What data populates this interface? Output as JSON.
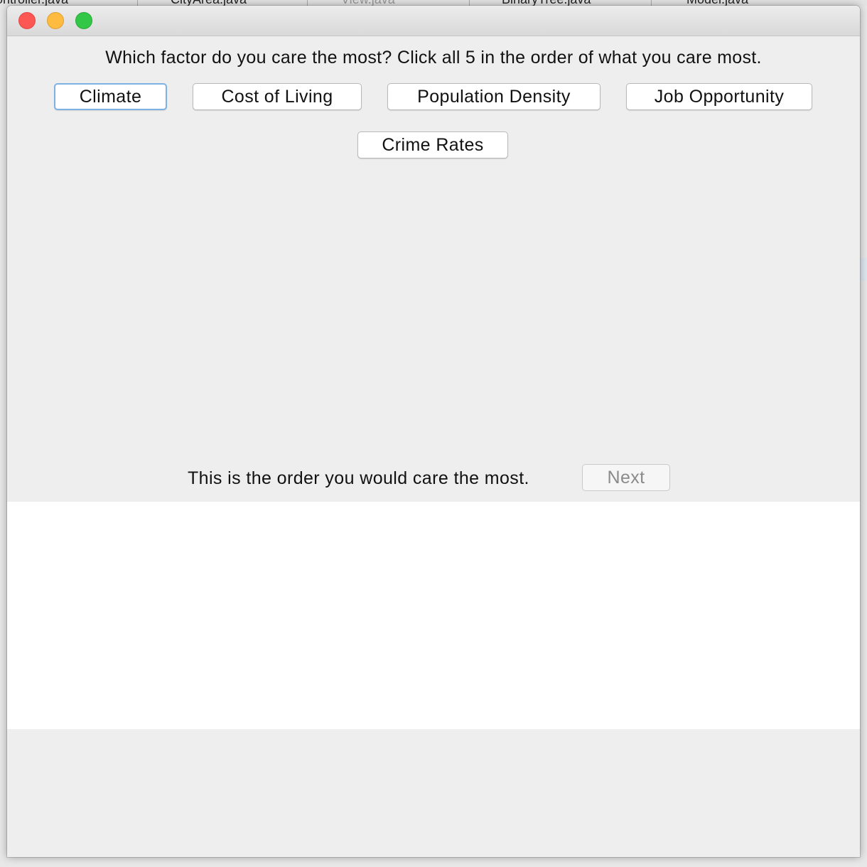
{
  "background": {
    "tabs": [
      {
        "label": "ontroller.java",
        "dim": false
      },
      {
        "label": "CityArea.java",
        "dim": false
      },
      {
        "label": "View.java",
        "dim": true
      },
      {
        "label": "BinaryTree.java",
        "dim": false
      },
      {
        "label": "Model.java",
        "dim": false
      }
    ]
  },
  "window": {
    "controls": {
      "close": "close-icon",
      "minimize": "minimize-icon",
      "maximize": "maximize-icon"
    },
    "question": "Which factor do you care the most? Click all 5 in the order of what you care most.",
    "factors": [
      {
        "label": "Climate"
      },
      {
        "label": "Cost of Living"
      },
      {
        "label": "Population Density"
      },
      {
        "label": "Job Opportunity"
      },
      {
        "label": "Crime Rates"
      }
    ],
    "order_label": "This is the order you would care the most.",
    "next_label": "Next",
    "result_text": ""
  },
  "colors": {
    "close": "#fc5753",
    "minimize": "#fdbc40",
    "maximize": "#33c748",
    "focus_ring": "#7eb1e4"
  }
}
